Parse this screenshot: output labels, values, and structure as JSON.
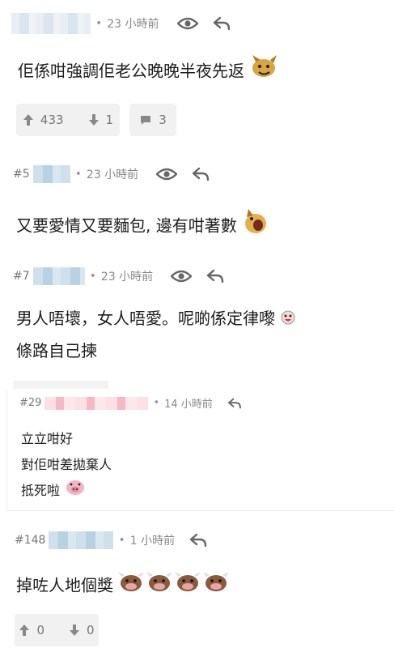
{
  "posts": [
    {
      "number": "",
      "time": "23 小時前",
      "lines": [
        "佢係咁強調佢老公晚晚半夜先返"
      ],
      "votes": {
        "up": "433",
        "down": "1",
        "comments": "3"
      }
    },
    {
      "number": "#5",
      "time": "23 小時前",
      "lines": [
        "又要愛情又要麵包, 邊有咁著數"
      ]
    },
    {
      "number": "#7",
      "time": "23 小時前",
      "lines": [
        "男人唔壞，女人唔愛。呢啲係定律嚟",
        "條路自己揀"
      ]
    },
    {
      "number": "#29",
      "time": "14 小時前",
      "lines": [
        "立立咁好",
        "對佢咁差拋棄人",
        "抵死啦"
      ]
    },
    {
      "number": "#148",
      "time": "1 小時前",
      "lines": [
        "掉咗人地個獎"
      ],
      "votes": {
        "up": "0",
        "down": "0"
      }
    }
  ],
  "icons": {
    "view": "eye-icon",
    "reply": "reply-icon",
    "upvote": "arrow-up-icon",
    "downvote": "arrow-down-icon",
    "comment": "comment-icon"
  },
  "colors": {
    "meta_text": "#888888",
    "vote_bg": "#f1f1f1"
  }
}
